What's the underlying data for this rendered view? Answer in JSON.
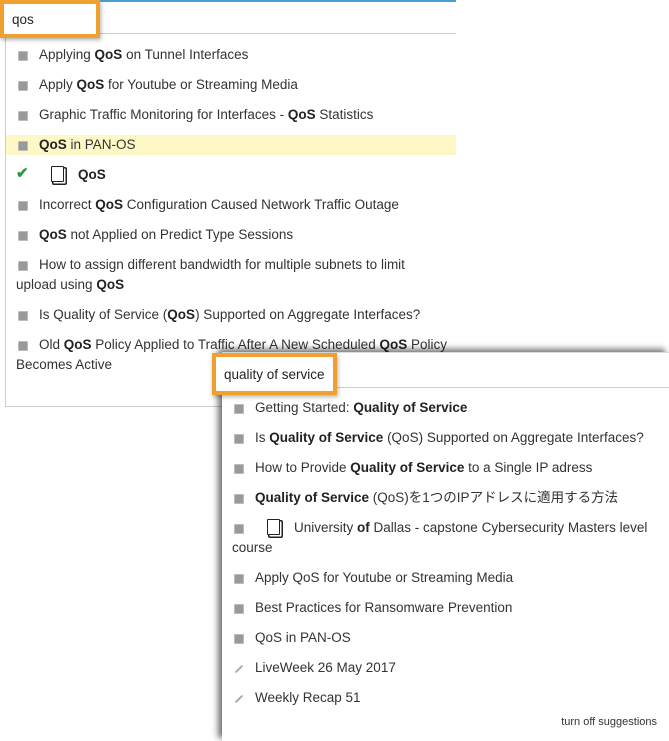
{
  "colors": {
    "accent_border": "#f0a030",
    "highlight": "#fdf8c6",
    "check": "#2a9a3a",
    "top_bar": "#4a9fd4"
  },
  "search1": {
    "value": "qos"
  },
  "search2": {
    "value": "quality of service"
  },
  "list1": [
    {
      "icon": "article-icon",
      "parts": [
        {
          "t": "Applying "
        },
        {
          "t": "QoS",
          "b": true
        },
        {
          "t": " on Tunnel Interfaces"
        }
      ]
    },
    {
      "icon": "article-icon",
      "parts": [
        {
          "t": "Apply "
        },
        {
          "t": "QoS",
          "b": true
        },
        {
          "t": " for Youtube or Streaming Media"
        }
      ]
    },
    {
      "icon": "article-icon",
      "parts": [
        {
          "t": "Graphic Traffic Monitoring for Interfaces - "
        },
        {
          "t": "QoS",
          "b": true
        },
        {
          "t": " Statistics"
        }
      ]
    },
    {
      "icon": "article-icon",
      "highlight": true,
      "parts": [
        {
          "t": "QoS",
          "b": true
        },
        {
          "t": " in PAN-OS"
        }
      ]
    },
    {
      "icon": "check-icon",
      "clip": true,
      "parts": [
        {
          "t": "QoS",
          "b": true
        }
      ]
    },
    {
      "icon": "article-icon",
      "parts": [
        {
          "t": "Incorrect "
        },
        {
          "t": "QoS",
          "b": true
        },
        {
          "t": " Configuration Caused Network Traffic Outage"
        }
      ]
    },
    {
      "icon": "article-icon",
      "parts": [
        {
          "t": "QoS",
          "b": true
        },
        {
          "t": " not Applied on Predict Type Sessions"
        }
      ]
    },
    {
      "icon": "article-icon",
      "wrap": true,
      "parts": [
        {
          "t": "How to assign different bandwidth for multiple subnets to limit upload using "
        },
        {
          "t": "QoS",
          "b": true
        }
      ]
    },
    {
      "icon": "article-icon",
      "parts": [
        {
          "t": "Is Quality of Service ("
        },
        {
          "t": "QoS",
          "b": true
        },
        {
          "t": ") Supported on Aggregate Interfaces?"
        }
      ]
    },
    {
      "icon": "article-icon",
      "wrap": true,
      "parts": [
        {
          "t": "Old "
        },
        {
          "t": "QoS",
          "b": true
        },
        {
          "t": " Policy Applied to Traffic After A New Scheduled "
        },
        {
          "t": "QoS",
          "b": true
        },
        {
          "t": " Policy Becomes Active"
        }
      ]
    }
  ],
  "list2": [
    {
      "icon": "article-icon",
      "parts": [
        {
          "t": "Getting Started: "
        },
        {
          "t": "Quality of Service",
          "b": true
        }
      ]
    },
    {
      "icon": "article-icon",
      "parts": [
        {
          "t": "Is "
        },
        {
          "t": "Quality of Service",
          "b": true
        },
        {
          "t": " (QoS) Supported on Aggregate Interfaces?"
        }
      ]
    },
    {
      "icon": "article-icon",
      "parts": [
        {
          "t": "How to Provide "
        },
        {
          "t": "Quality of Service",
          "b": true
        },
        {
          "t": " to a Single IP adress"
        }
      ]
    },
    {
      "icon": "article-icon",
      "parts": [
        {
          "t": "Quality of Service",
          "b": true
        },
        {
          "t": " (QoS)を1つのIPアドレスに適用する方法"
        }
      ]
    },
    {
      "icon": "article-icon",
      "clip": true,
      "wrap": true,
      "parts": [
        {
          "t": "University "
        },
        {
          "t": "of",
          "b": true
        },
        {
          "t": " Dallas - capstone Cybersecurity Masters level course"
        }
      ]
    },
    {
      "icon": "article-icon",
      "parts": [
        {
          "t": "Apply QoS for Youtube or Streaming Media"
        }
      ]
    },
    {
      "icon": "article-icon",
      "parts": [
        {
          "t": "Best Practices for Ransomware Prevention"
        }
      ]
    },
    {
      "icon": "article-icon",
      "parts": [
        {
          "t": "QoS in PAN-OS"
        }
      ]
    },
    {
      "icon": "pencil-icon",
      "parts": [
        {
          "t": "LiveWeek 26 May 2017"
        }
      ]
    },
    {
      "icon": "pencil-icon",
      "parts": [
        {
          "t": "Weekly Recap 51"
        }
      ]
    }
  ],
  "turn_off": "turn off suggestions"
}
